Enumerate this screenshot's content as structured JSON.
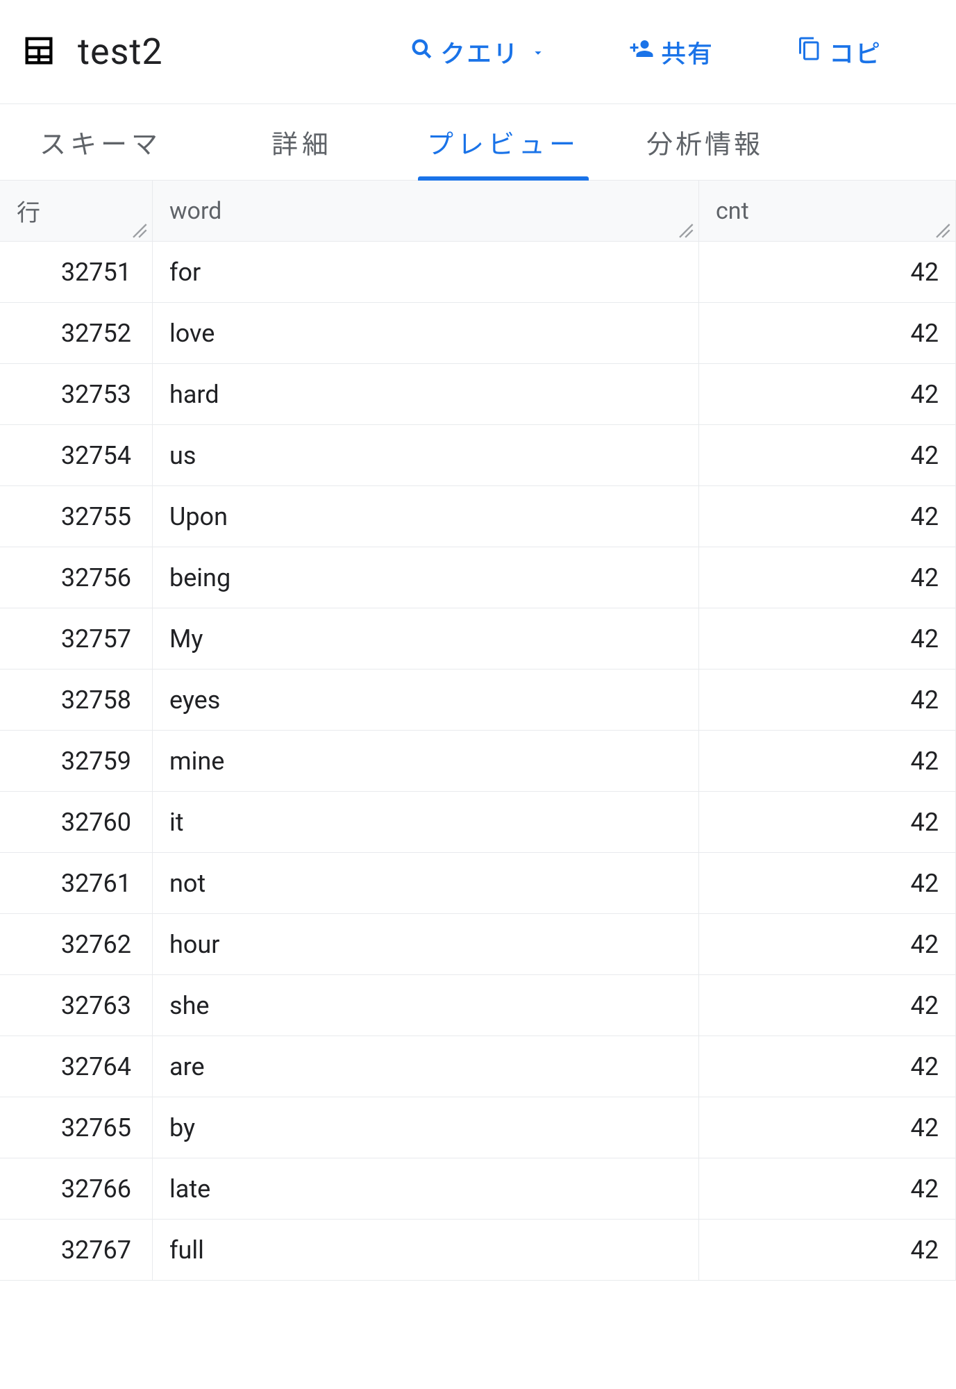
{
  "header": {
    "title": "test2",
    "actions": {
      "query_label": "クエリ",
      "share_label": "共有",
      "copy_label": "コピ"
    }
  },
  "tabs": {
    "schema": "スキーマ",
    "details": "詳細",
    "preview": "プレビュー",
    "insights": "分析情報",
    "active": "preview"
  },
  "table": {
    "columns": {
      "row": "行",
      "word": "word",
      "cnt": "cnt"
    },
    "rows": [
      {
        "row": "32751",
        "word": "for",
        "cnt": "42"
      },
      {
        "row": "32752",
        "word": "love",
        "cnt": "42"
      },
      {
        "row": "32753",
        "word": "hard",
        "cnt": "42"
      },
      {
        "row": "32754",
        "word": "us",
        "cnt": "42"
      },
      {
        "row": "32755",
        "word": "Upon",
        "cnt": "42"
      },
      {
        "row": "32756",
        "word": "being",
        "cnt": "42"
      },
      {
        "row": "32757",
        "word": "My",
        "cnt": "42"
      },
      {
        "row": "32758",
        "word": "eyes",
        "cnt": "42"
      },
      {
        "row": "32759",
        "word": "mine",
        "cnt": "42"
      },
      {
        "row": "32760",
        "word": "it",
        "cnt": "42"
      },
      {
        "row": "32761",
        "word": "not",
        "cnt": "42"
      },
      {
        "row": "32762",
        "word": "hour",
        "cnt": "42"
      },
      {
        "row": "32763",
        "word": "she",
        "cnt": "42"
      },
      {
        "row": "32764",
        "word": "are",
        "cnt": "42"
      },
      {
        "row": "32765",
        "word": "by",
        "cnt": "42"
      },
      {
        "row": "32766",
        "word": "late",
        "cnt": "42"
      },
      {
        "row": "32767",
        "word": "full",
        "cnt": "42"
      }
    ]
  },
  "icons": {
    "table": "table-icon",
    "search": "search-icon",
    "caret_down": "caret-down-icon",
    "person_add": "person-add-icon",
    "copy": "copy-icon",
    "resize": "resize-handle-icon"
  }
}
